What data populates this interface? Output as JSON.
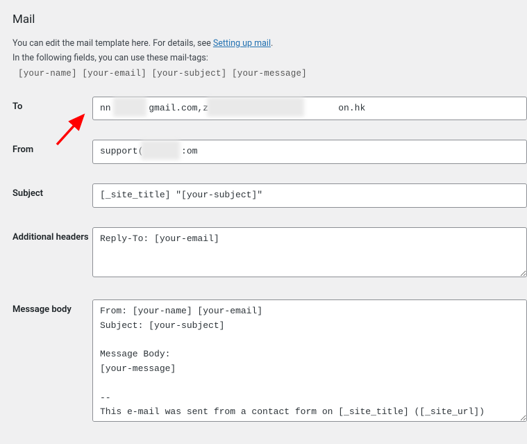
{
  "section_title": "Mail",
  "intro": {
    "line1_before": "You can edit the mail template here. For details, see ",
    "link_text": "Setting up mail",
    "line1_after": ".",
    "line2": "In the following fields, you can use these mail-tags:"
  },
  "mail_tags": "[your-name] [your-email] [your-subject] [your-message]",
  "labels": {
    "to": "To",
    "from": "From",
    "subject": "Subject",
    "additional_headers": "Additional headers",
    "message_body": "Message body"
  },
  "fields": {
    "to": "nn       gmail.com,z                        on.hk",
    "from": "support(       :om",
    "subject": "[_site_title] \"[your-subject]\"",
    "additional_headers": "Reply-To: [your-email]",
    "message_body": "From: [your-name] [your-email]\nSubject: [your-subject]\n\nMessage Body:\n[your-message]\n\n--\nThis e-mail was sent from a contact form on [_site_title] ([_site_url])"
  }
}
